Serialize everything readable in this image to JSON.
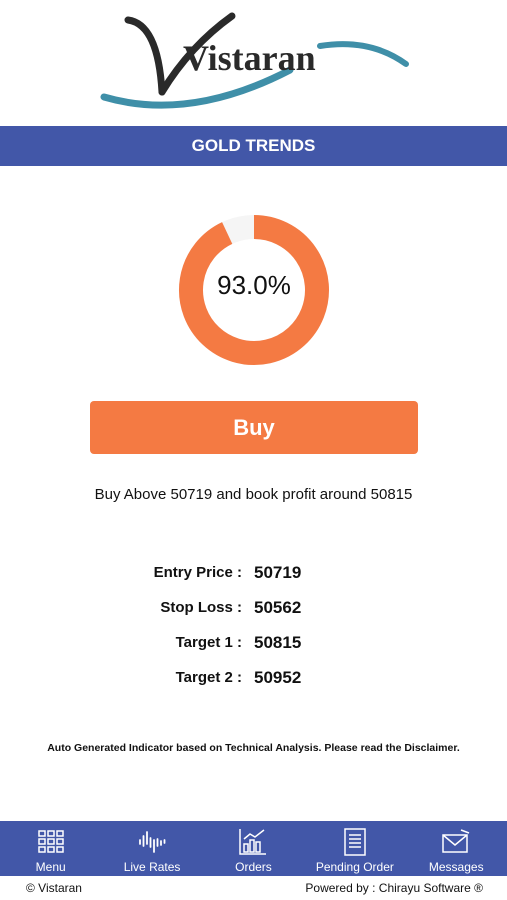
{
  "brand": {
    "logo_text": "Vistaran"
  },
  "header": {
    "title": "GOLD TRENDS"
  },
  "signal": {
    "percent": 93.0,
    "percent_label": "93.0%",
    "action": "Buy",
    "advice": "Buy Above 50719 and book profit around 50815"
  },
  "levels": [
    {
      "label": "Entry Price :",
      "value": "50719"
    },
    {
      "label": "Stop Loss :",
      "value": "50562"
    },
    {
      "label": "Target 1 :",
      "value": "50815"
    },
    {
      "label": "Target 2 :",
      "value": "50952"
    }
  ],
  "disclaimer": "Auto Generated Indicator based on Technical Analysis. Please read the Disclaimer.",
  "nav": [
    {
      "label": "Menu",
      "icon": "grid-icon"
    },
    {
      "label": "Live Rates",
      "icon": "waveform-icon"
    },
    {
      "label": "Orders",
      "icon": "bar-chart-icon"
    },
    {
      "label": "Pending Order",
      "icon": "document-icon"
    },
    {
      "label": "Messages",
      "icon": "envelope-icon"
    }
  ],
  "footer": {
    "copyright": "© Vistaran",
    "powered_by": "Powered by : Chirayu Software ®"
  },
  "colors": {
    "accent": "#f47a43",
    "nav_bg": "#4257a8",
    "logo_teal": "#3f8fa8"
  }
}
